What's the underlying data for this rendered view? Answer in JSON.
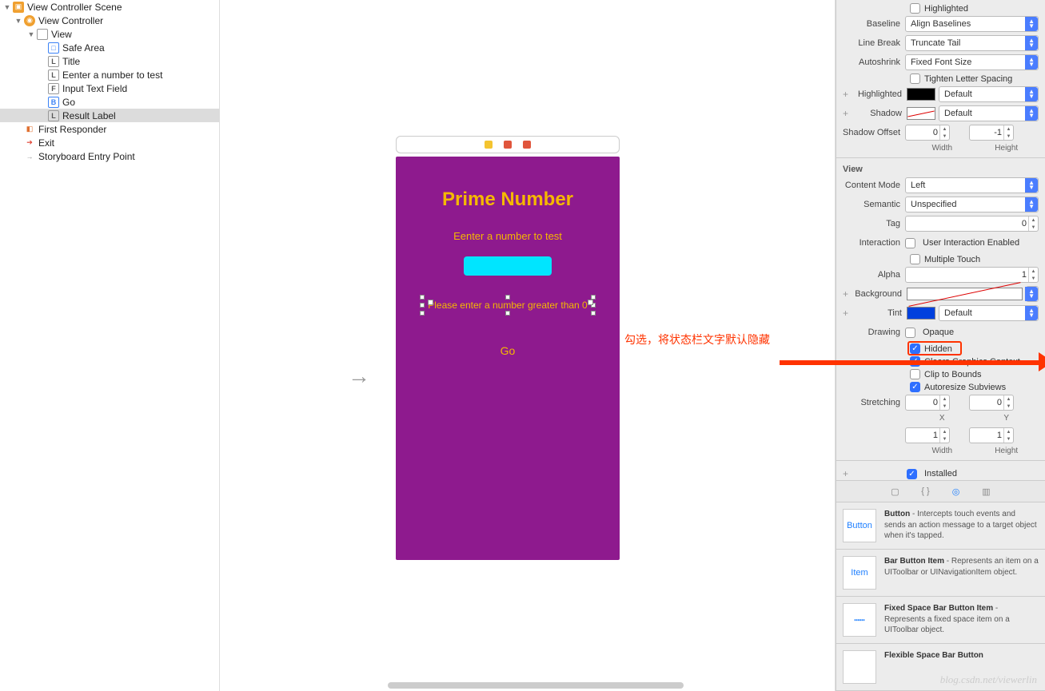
{
  "navigator": {
    "scene": "View Controller Scene",
    "vc": "View Controller",
    "view": "View",
    "items": [
      {
        "icon": "safe",
        "glyph": "□",
        "label": "Safe Area"
      },
      {
        "icon": "label",
        "glyph": "L",
        "label": "Title"
      },
      {
        "icon": "label",
        "glyph": "L",
        "label": "Eenter a number to test"
      },
      {
        "icon": "field",
        "glyph": "F",
        "label": "Input Text Field"
      },
      {
        "icon": "btn",
        "glyph": "B",
        "label": "Go"
      },
      {
        "icon": "label",
        "glyph": "L",
        "label": "Result Label",
        "selected": true
      }
    ],
    "first_responder": "First Responder",
    "exit": "Exit",
    "entry_point": "Storyboard Entry Point"
  },
  "phone": {
    "title": "Prime Number",
    "subtitle": "Eenter a number to test",
    "result": "Please enter a number greater than 0",
    "go": "Go"
  },
  "annotation": "勾选，将状态栏文字默认隐藏",
  "inspector": {
    "highlighted_label": "Highlighted",
    "baseline": {
      "label": "Baseline",
      "value": "Align Baselines"
    },
    "line_break": {
      "label": "Line Break",
      "value": "Truncate Tail"
    },
    "autoshrink": {
      "label": "Autoshrink",
      "value": "Fixed Font Size"
    },
    "tighten": "Tighten Letter Spacing",
    "highlighted_row": {
      "label": "Highlighted",
      "value": "Default"
    },
    "shadow": {
      "label": "Shadow",
      "value": "Default"
    },
    "shadow_offset": {
      "label": "Shadow Offset",
      "w": "0",
      "h": "-1",
      "wl": "Width",
      "hl": "Height"
    },
    "view_section": "View",
    "content_mode": {
      "label": "Content Mode",
      "value": "Left"
    },
    "semantic": {
      "label": "Semantic",
      "value": "Unspecified"
    },
    "tag": {
      "label": "Tag",
      "value": "0"
    },
    "interaction": {
      "label": "Interaction",
      "uie": "User Interaction Enabled",
      "mt": "Multiple Touch"
    },
    "alpha": {
      "label": "Alpha",
      "value": "1"
    },
    "background": {
      "label": "Background"
    },
    "tint": {
      "label": "Tint",
      "value": "Default"
    },
    "drawing": {
      "label": "Drawing",
      "opaque": "Opaque",
      "hidden": "Hidden",
      "clears": "Clears Graphics Context",
      "clip": "Clip to Bounds",
      "autoresize": "Autoresize Subviews"
    },
    "stretching": {
      "label": "Stretching",
      "x": "0",
      "y": "0",
      "w": "1",
      "h": "1",
      "xl": "X",
      "yl": "Y",
      "wl": "Width",
      "hl": "Height"
    },
    "installed": "Installed"
  },
  "library": [
    {
      "icon": "Button",
      "title": "Button",
      "desc": " - Intercepts touch events and sends an action message to a target object when it's tapped."
    },
    {
      "icon": "Item",
      "title": "Bar Button Item",
      "desc": " - Represents an item on a UIToolbar or UINavigationItem object."
    },
    {
      "icon": "┅┅",
      "title": "Fixed Space Bar Button Item",
      "desc": " - Represents a fixed space item on a UIToolbar object."
    },
    {
      "icon": "",
      "title": "Flexible Space Bar Button",
      "desc": ""
    }
  ],
  "watermark": "blog.csdn.net/viewerlin"
}
